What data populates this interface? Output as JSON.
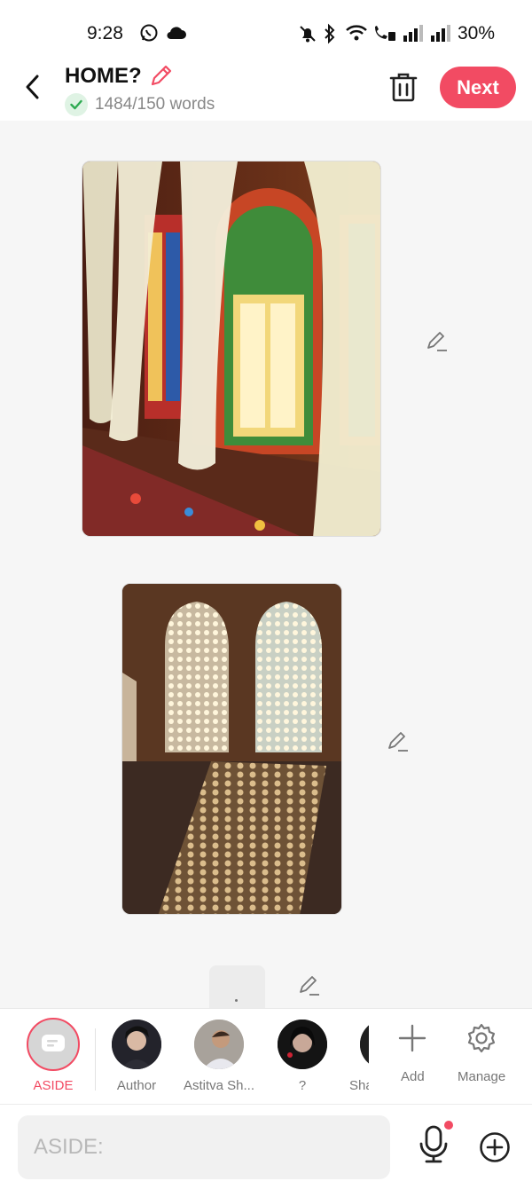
{
  "status_bar": {
    "time": "9:28",
    "battery": "30%",
    "icons": [
      "whatsapp-icon",
      "cloud-icon",
      "mute-icon",
      "bluetooth-icon",
      "wifi-icon",
      "wifi-calling-icon",
      "signal-icon",
      "signal-icon"
    ]
  },
  "header": {
    "title": "HOME?",
    "word_count": "1484/150 words",
    "next_label": "Next",
    "accent_color": "#f24b63"
  },
  "content": {
    "images": [
      {
        "name": "stained-glass-windows-image",
        "description_icon": "image"
      },
      {
        "name": "jali-lattice-windows-image",
        "description_icon": "image"
      }
    ]
  },
  "characters": {
    "items": [
      {
        "label": "ASIDE",
        "selected": true
      },
      {
        "label": "Author"
      },
      {
        "label": "Astitva Sh..."
      },
      {
        "label": "?"
      },
      {
        "label": "Sha"
      }
    ],
    "add_label": "Add",
    "manage_label": "Manage"
  },
  "input": {
    "placeholder": "ASIDE:"
  }
}
